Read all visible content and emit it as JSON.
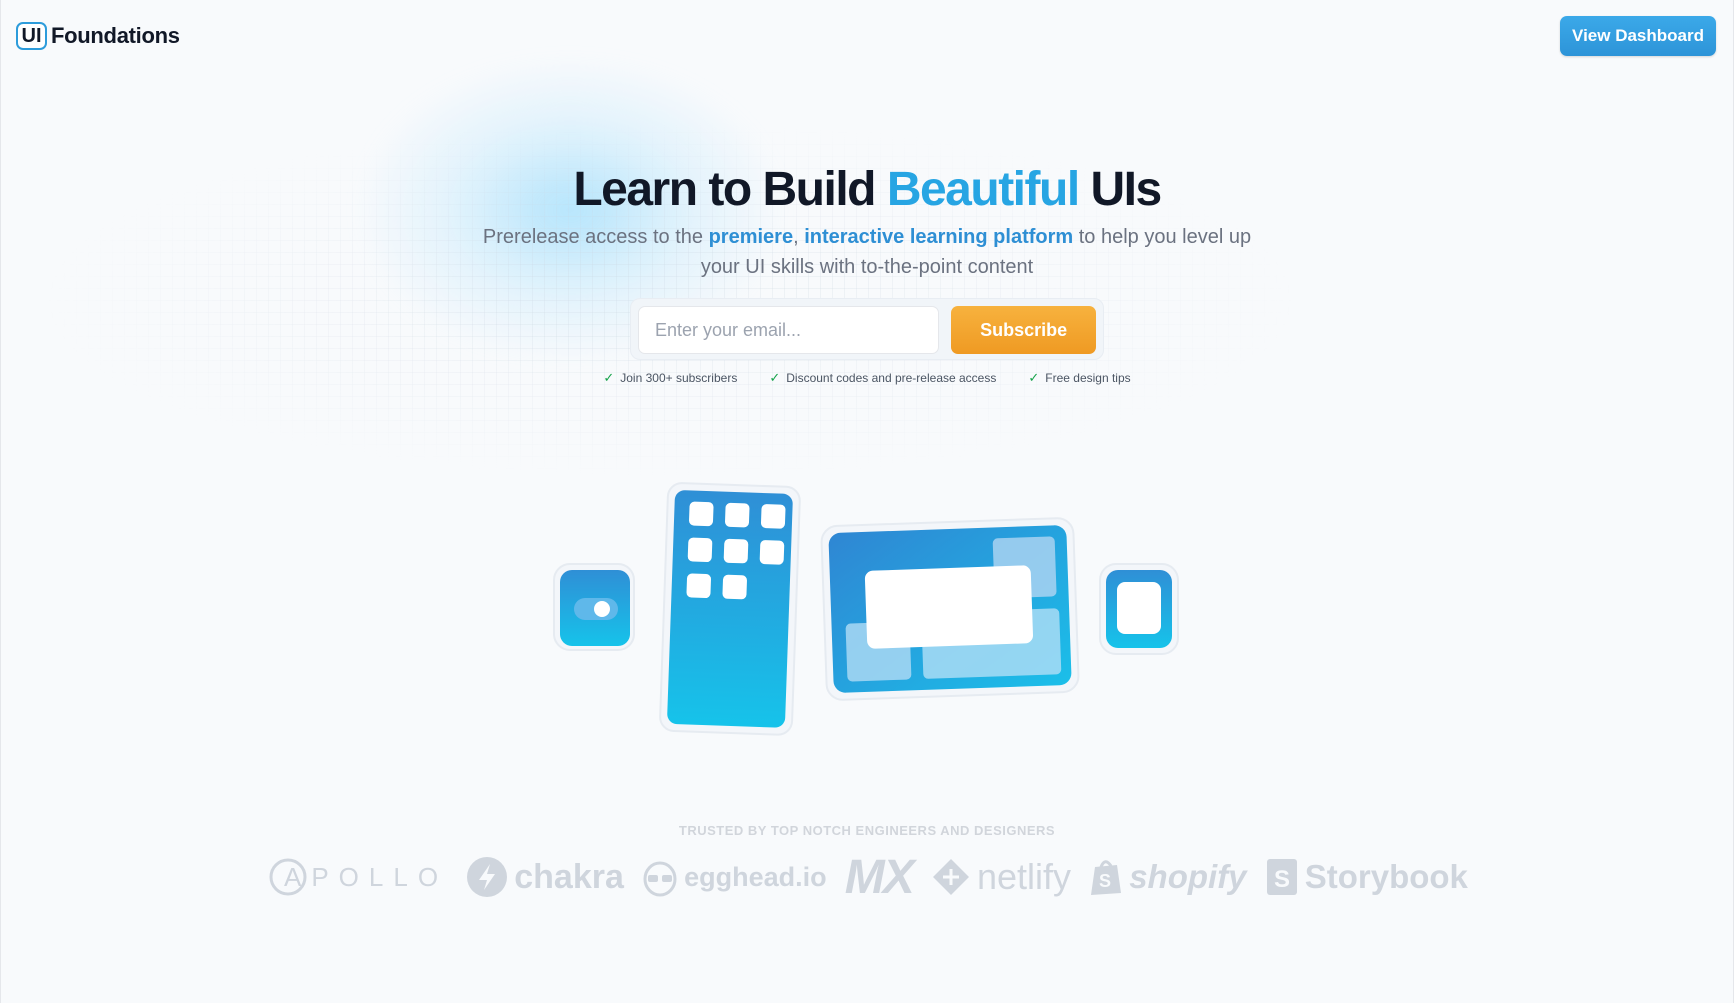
{
  "header": {
    "logo_mark": "UI",
    "logo_text": "Foundations",
    "dashboard_button": "View Dashboard"
  },
  "hero": {
    "title_part1": "Learn to Build ",
    "title_accent": "Beautiful",
    "title_part2": " UIs",
    "subtitle_part1": "Prerelease access to the ",
    "subtitle_hl1": "premiere",
    "subtitle_sep": ", ",
    "subtitle_hl2": "interactive learning platform",
    "subtitle_part2": " to help you level up your UI skills with to-the-point content"
  },
  "form": {
    "email_placeholder": "Enter your email...",
    "email_value": "",
    "subscribe_label": "Subscribe"
  },
  "perks": [
    {
      "text": "Join 300+ subscribers",
      "icon": "check-icon"
    },
    {
      "text": "Discount codes and pre-release access",
      "icon": "check-icon"
    },
    {
      "text": "Free design tips",
      "icon": "check-icon"
    }
  ],
  "trusted": {
    "label": "TRUSTED BY TOP NOTCH ENGINEERS AND DESIGNERS",
    "brands": [
      {
        "name": "APOLLO",
        "icon": "apollo-logo"
      },
      {
        "name": "chakra",
        "icon": "chakra-logo"
      },
      {
        "name": "egghead.io",
        "icon": "egghead-logo"
      },
      {
        "name": "MX",
        "icon": "mx-logo"
      },
      {
        "name": "netlify",
        "icon": "netlify-logo"
      },
      {
        "name": "shopify",
        "icon": "shopify-logo"
      },
      {
        "name": "Storybook",
        "icon": "storybook-logo"
      }
    ]
  },
  "colors": {
    "accent_blue": "#27a5e3",
    "cta_orange": "#f2a52e",
    "dashboard_button": "#3ba9e9",
    "check_green": "#16a34a"
  }
}
